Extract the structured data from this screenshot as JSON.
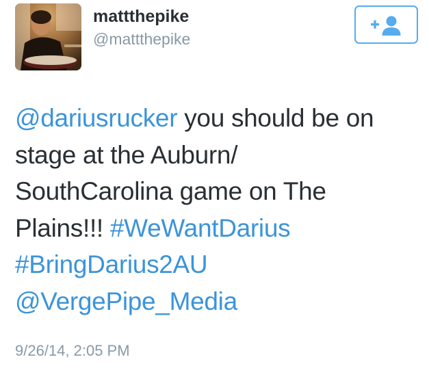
{
  "user": {
    "display_name": "mattthepike",
    "handle": "@mattthepike"
  },
  "follow_button": {
    "icon": "add-user-icon"
  },
  "tweet": {
    "line1": {
      "mention": "@dariusrucker",
      "text": " you should be on"
    },
    "line2": {
      "text": "stage at the Auburn/"
    },
    "line3": {
      "text": "SouthCarolina game on The"
    },
    "line4": {
      "text": "Plains!!! ",
      "hashtag": "#WeWantDarius"
    },
    "line5": {
      "hashtag": "#BringDarius2AU"
    },
    "line6": {
      "mention": "@VergePipe_Media"
    },
    "timestamp": "9/26/14, 2:05 PM"
  },
  "colors": {
    "link": "#3b94d9",
    "text": "#292f33",
    "muted": "#8899a6",
    "button_border": "#55acee"
  }
}
